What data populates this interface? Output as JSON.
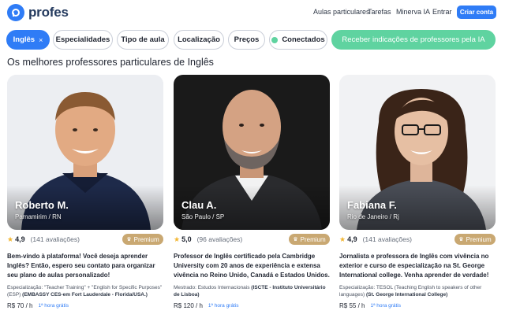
{
  "header": {
    "brand": "profes",
    "nav": [
      "Aulas particulares",
      "Tarefas",
      "Minerva IA",
      "Entrar"
    ],
    "cta": "Criar conta",
    "accent": "#2f7cf6"
  },
  "filters": {
    "active": {
      "label": "Inglês",
      "remove_icon": "×"
    },
    "items": [
      "Especialidades",
      "Tipo de aula",
      "Localização",
      "Preços",
      "Conectados"
    ],
    "ia_button": "Receber indicações de professores pela IA",
    "green": "#5fd3a0"
  },
  "section_title": "Os melhores professores particulares de Inglês",
  "cards": [
    {
      "name": "Roberto M.",
      "location": "Pamamirim / RN",
      "rating": "4,9",
      "reviews": "(141 avaliações)",
      "badge": "Premium",
      "description": "Bem-vindo à plataforma! Você deseja aprender Inglês? Então, espero seu contato para organizar seu plano de aulas personalizado!",
      "spec_label": "Especialização:",
      "spec_text": "\"Teacher Training\" + \"English for Specific Purposes\" (ESP)",
      "spec_bold": "(EMBASSY CES-em Fort Lauderdale - Florida/USA.)",
      "price": "R$ 70 / h",
      "free": "1ª hora grátis"
    },
    {
      "name": "Clau A.",
      "location": "São Paulo / SP",
      "rating": "5,0",
      "reviews": "(96 avaliações)",
      "badge": "Premium",
      "description": "Professor de Inglês certificado pela Cambridge University com 20 anos de experiência e extensa vivência no Reino Unido, Canadá e Estados Unidos.",
      "spec_label": "Mestrado:",
      "spec_text": "Estudos Internacionais",
      "spec_bold": "(ISCTE - Instituto Universitário de Lisboa)",
      "price": "R$ 120 / h",
      "free": "1ª hora grátis"
    },
    {
      "name": "Fabiana F.",
      "location": "Rio de Janeiro / Rj",
      "rating": "4,9",
      "reviews": "(141 avaliações)",
      "badge": "Premium",
      "description": "Jornalista e professora de Inglês com vivência no exterior e curso de especialização na St. George International college. Venha aprender de verdade!",
      "spec_label": "Especialização:",
      "spec_text": "TESOL (Teaching English to speakers of other languages)",
      "spec_bold": "(St. George International College)",
      "price": "R$ 55 / h",
      "free": "1ª hora grátis"
    }
  ]
}
